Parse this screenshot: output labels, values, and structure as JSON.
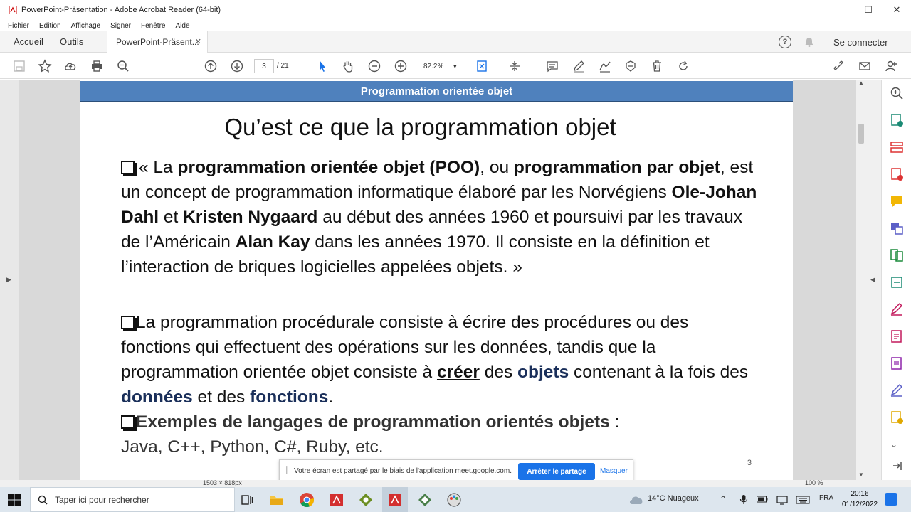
{
  "window": {
    "title": "PowerPoint-Präsentation - Adobe Acrobat Reader (64-bit)",
    "minimize": "–",
    "maximize": "☐",
    "close": "✕"
  },
  "menu": [
    "Fichier",
    "Edition",
    "Affichage",
    "Signer",
    "Fenêtre",
    "Aide"
  ],
  "nav": {
    "home": "Accueil",
    "tools": "Outils",
    "doc_tab": "PowerPoint-Präsent...",
    "doc_tab_close": "✕",
    "help": "?",
    "signin": "Se connecter"
  },
  "toolbar": {
    "page_current": "3",
    "page_total": "/ 21",
    "zoom": "82.2%"
  },
  "slide": {
    "banner": "Programmation orientée objet",
    "title": "Qu’est ce que la programmation objet",
    "p1": {
      "t1": "« La ",
      "b1": "programmation orientée objet (POO)",
      "t2": ", ou ",
      "b2": "programmation par objet",
      "t3": ", est un concept de programmation informatique élaboré par les Norvégiens ",
      "b3": "Ole-Johan Dahl",
      "t4": " et ",
      "b4": "Kristen Nygaard",
      "t5": " au début des années 1960 et poursuivi par les travaux de l’Américain ",
      "b5": "Alan Kay",
      "t6": " dans les années 1970. Il consiste en la définition et l’interaction de briques logicielles appelées objets.  »"
    },
    "p2": {
      "t1": "La programmation procédurale consiste à écrire des procédures ou des fonctions qui effectuent des opérations sur les données, tandis que la programmation orientée objet consiste à ",
      "u1": "créer",
      "t2": " des ",
      "n1": "objets",
      "t3": " contenant à la fois des ",
      "n2": "données",
      "t4": " et des ",
      "n3": "fonctions",
      "t5": "."
    },
    "p3": {
      "b1": "Exemples de langages de programmation orientés objets",
      "t1": " :",
      "t2": "Java, C++, Python, C#, Ruby, etc."
    },
    "page_number": "3"
  },
  "share": {
    "message": "Votre écran est partagé par le biais de l'application meet.google.com.",
    "stop": "Arrêter le partage",
    "hide": "Masquer"
  },
  "status": {
    "dimensions": "1503 × 818px",
    "zoom": "100 %"
  },
  "taskbar": {
    "search_placeholder": "Taper ici pour rechercher",
    "weather": "14°C  Nuageux",
    "lang": "FRA",
    "time": "20:16",
    "date": "01/12/2022"
  },
  "colors": {
    "banner": "#4f81bd",
    "accent_blue": "#1a73e8",
    "navy_text": "#1a2f5a"
  }
}
